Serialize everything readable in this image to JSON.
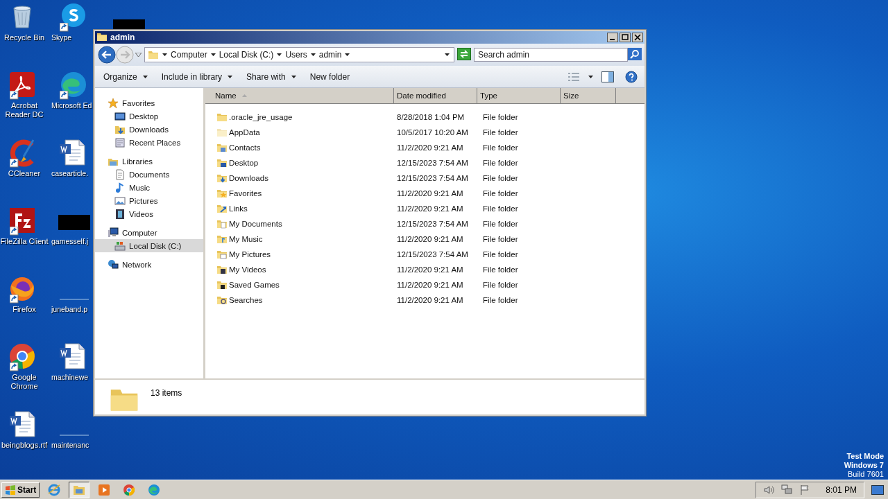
{
  "desktop": {
    "columns": [
      [
        {
          "label": "Recycle Bin",
          "kind": "recycle",
          "shortcut": false
        },
        {
          "label": "Acrobat Reader DC",
          "kind": "acrobat",
          "shortcut": true
        },
        {
          "label": "CCleaner",
          "kind": "ccleaner",
          "shortcut": true
        },
        {
          "label": "FileZilla Client",
          "kind": "filezilla",
          "shortcut": true
        },
        {
          "label": "Firefox",
          "kind": "firefox",
          "shortcut": true
        },
        {
          "label": "Google Chrome",
          "kind": "chrome",
          "shortcut": true
        },
        {
          "label": "beingblogs.rtf",
          "kind": "word",
          "shortcut": false
        }
      ],
      [
        {
          "label": "Skype",
          "kind": "skype",
          "shortcut": true
        },
        {
          "label": "Microsoft Ed",
          "kind": "edge",
          "shortcut": true
        },
        {
          "label": "casearticle.",
          "kind": "word",
          "shortcut": false
        },
        {
          "label": "gamesself.j",
          "kind": "redacted",
          "shortcut": false
        },
        {
          "label": "juneband.p",
          "kind": "blank",
          "shortcut": false
        },
        {
          "label": "machinewe",
          "kind": "word",
          "shortcut": false
        },
        {
          "label": "maintenanc",
          "kind": "blank",
          "shortcut": false
        }
      ]
    ],
    "system_text": [
      "Test Mode",
      "Windows 7",
      "Build 7601"
    ]
  },
  "window": {
    "title": "admin",
    "address": {
      "crumbs": [
        "Computer",
        "Local Disk (C:)",
        "Users",
        "admin"
      ]
    },
    "search": {
      "placeholder": "Search admin"
    },
    "toolbar": [
      {
        "label": "Organize",
        "dropdown": true
      },
      {
        "label": "Include in library",
        "dropdown": true
      },
      {
        "label": "Share with",
        "dropdown": true
      },
      {
        "label": "New folder",
        "dropdown": false
      }
    ],
    "sidebar": {
      "items": [
        {
          "label": "Favorites",
          "kind": "star",
          "selected": false,
          "children": [
            {
              "label": "Desktop",
              "kind": "desktop",
              "selected": false
            },
            {
              "label": "Downloads",
              "kind": "downloads",
              "selected": false
            },
            {
              "label": "Recent Places",
              "kind": "recent",
              "selected": false
            }
          ]
        },
        {
          "label": "Libraries",
          "kind": "libraries",
          "selected": false,
          "children": [
            {
              "label": "Documents",
              "kind": "doc",
              "selected": false
            },
            {
              "label": "Music",
              "kind": "music",
              "selected": false
            },
            {
              "label": "Pictures",
              "kind": "pictures",
              "selected": false
            },
            {
              "label": "Videos",
              "kind": "videos",
              "selected": false
            }
          ]
        },
        {
          "label": "Computer",
          "kind": "computer",
          "selected": false,
          "children": [
            {
              "label": "Local Disk (C:)",
              "kind": "disk",
              "selected": true
            }
          ]
        },
        {
          "label": "Network",
          "kind": "network",
          "selected": false
        }
      ]
    },
    "table": {
      "columns": [
        {
          "label": "Name",
          "sorted": true
        },
        {
          "label": "Date modified",
          "sorted": false
        },
        {
          "label": "Type",
          "sorted": false
        },
        {
          "label": "Size",
          "sorted": false
        }
      ],
      "rows": [
        {
          "name": ".oracle_jre_usage",
          "date": "8/28/2018 1:04 PM",
          "type": "File folder",
          "kind": "plain",
          "hidden": false
        },
        {
          "name": "AppData",
          "date": "10/5/2017 10:20 AM",
          "type": "File folder",
          "kind": "plain",
          "hidden": true
        },
        {
          "name": "Contacts",
          "date": "11/2/2020 9:21 AM",
          "type": "File folder",
          "kind": "contacts",
          "hidden": false
        },
        {
          "name": "Desktop",
          "date": "12/15/2023 7:54 AM",
          "type": "File folder",
          "kind": "desktop",
          "hidden": false
        },
        {
          "name": "Downloads",
          "date": "12/15/2023 7:54 AM",
          "type": "File folder",
          "kind": "downloads",
          "hidden": false
        },
        {
          "name": "Favorites",
          "date": "11/2/2020 9:21 AM",
          "type": "File folder",
          "kind": "favorites",
          "hidden": false
        },
        {
          "name": "Links",
          "date": "11/2/2020 9:21 AM",
          "type": "File folder",
          "kind": "links",
          "hidden": false
        },
        {
          "name": "My Documents",
          "date": "12/15/2023 7:54 AM",
          "type": "File folder",
          "kind": "documents",
          "hidden": false
        },
        {
          "name": "My Music",
          "date": "11/2/2020 9:21 AM",
          "type": "File folder",
          "kind": "music",
          "hidden": false
        },
        {
          "name": "My Pictures",
          "date": "12/15/2023 7:54 AM",
          "type": "File folder",
          "kind": "pictures",
          "hidden": false
        },
        {
          "name": "My Videos",
          "date": "11/2/2020 9:21 AM",
          "type": "File folder",
          "kind": "videos",
          "hidden": false
        },
        {
          "name": "Saved Games",
          "date": "11/2/2020 9:21 AM",
          "type": "File folder",
          "kind": "games",
          "hidden": false
        },
        {
          "name": "Searches",
          "date": "11/2/2020 9:21 AM",
          "type": "File folder",
          "kind": "searches",
          "hidden": false
        }
      ]
    },
    "status_bar": {
      "count": "13 items"
    }
  },
  "taskbar": {
    "start": "Start",
    "apps": [
      {
        "kind": "ie",
        "selected": false
      },
      {
        "kind": "explorer",
        "selected": true
      },
      {
        "kind": "media",
        "selected": false
      },
      {
        "kind": "chrome",
        "selected": false
      },
      {
        "kind": "edge",
        "selected": false
      }
    ],
    "clock": "8:01 PM"
  }
}
